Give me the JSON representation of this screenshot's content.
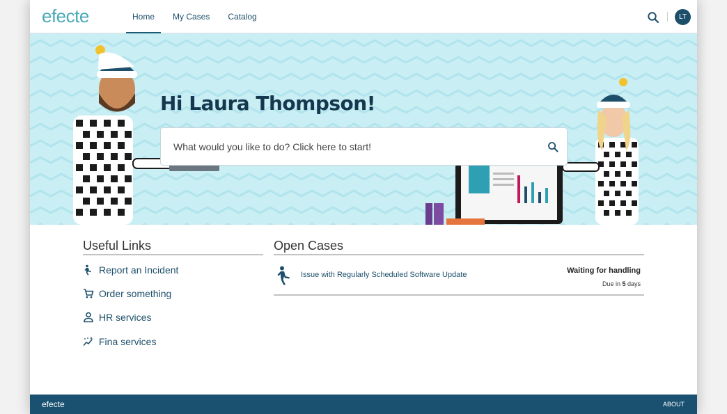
{
  "header": {
    "logo": "efecte",
    "nav": [
      {
        "label": "Home",
        "active": true
      },
      {
        "label": "My Cases",
        "active": false
      },
      {
        "label": "Catalog",
        "active": false
      }
    ],
    "avatar_initials": "LT"
  },
  "hero": {
    "greeting": "Hi Laura Thompson!",
    "search_placeholder": "What would you like to do? Click here to start!"
  },
  "useful_links": {
    "title": "Useful Links",
    "items": [
      {
        "label": "Report an Incident",
        "icon": "person-falling-icon"
      },
      {
        "label": "Order something",
        "icon": "cart-icon"
      },
      {
        "label": "HR services",
        "icon": "person-icon"
      },
      {
        "label": "Fina services",
        "icon": "sparkle-icon"
      }
    ]
  },
  "open_cases": {
    "title": "Open Cases",
    "items": [
      {
        "title": "Issue with Regularly Scheduled Software Update",
        "status": "Waiting for handling",
        "due_prefix": "Due in ",
        "due_value": "5",
        "due_suffix": " days",
        "icon": "person-falling-icon"
      }
    ]
  },
  "footer": {
    "logo": "efecte",
    "about": "ABOUT"
  },
  "colors": {
    "brand": "#1d4f6b",
    "logo": "#4aa9b8",
    "hero_bg": "#c9eef3",
    "footer_bg": "#1a5170"
  }
}
